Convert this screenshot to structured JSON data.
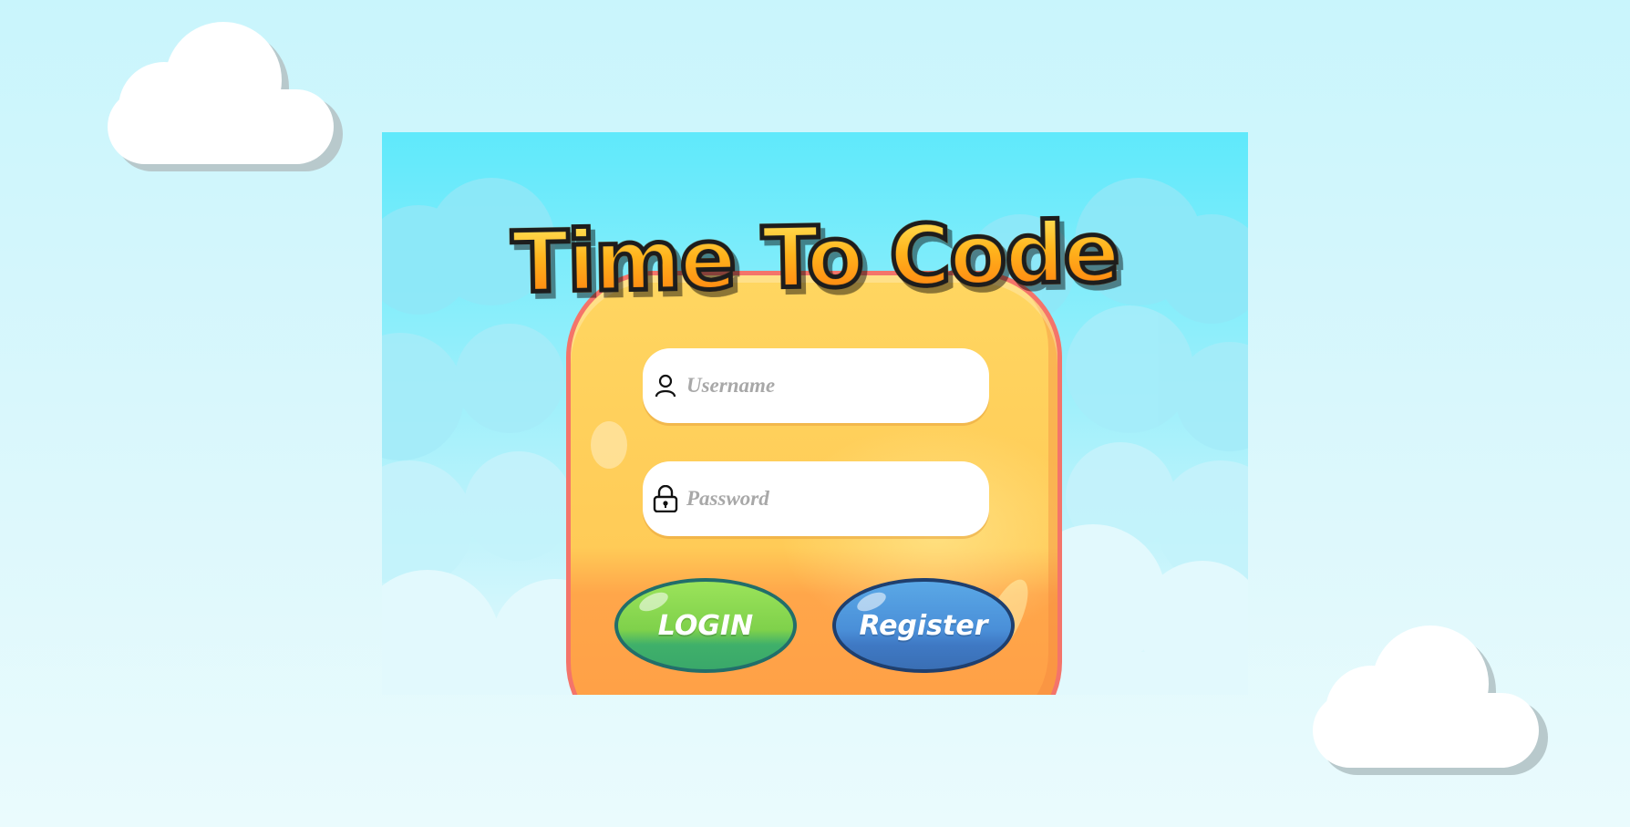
{
  "game": {
    "title": "Time To Code"
  },
  "form": {
    "username_placeholder": "Username",
    "username_value": "",
    "password_placeholder": "Password",
    "password_value": "",
    "login_label": "LOGIN",
    "register_label": "Register"
  },
  "icons": {
    "username": "user-icon",
    "password": "lock-icon"
  },
  "colors": {
    "login_button": "#7fd14b",
    "register_button": "#4a8fd8",
    "card": "#ffcb57",
    "card_border": "#f4746a",
    "title": "#ff9a0a",
    "sky": "#5fe9fb"
  }
}
